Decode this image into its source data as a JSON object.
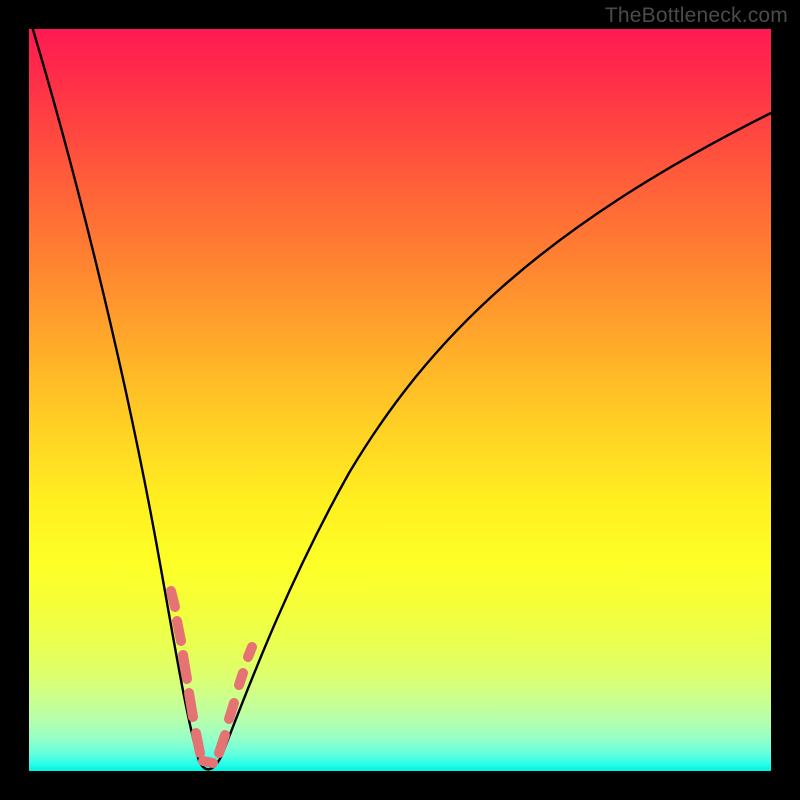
{
  "watermark": "TheBottleneck.com",
  "colors": {
    "frame": "#000000",
    "curve": "#000000",
    "marker": "#e57373",
    "gradient_stops": [
      {
        "pos": 0.0,
        "color": "#ff1a52"
      },
      {
        "pos": 0.5,
        "color": "#ffd224"
      },
      {
        "pos": 1.0,
        "color": "#00f3e0"
      }
    ]
  },
  "chart_data": {
    "type": "line",
    "title": "",
    "xlabel": "",
    "ylabel": "",
    "xlim": [
      0,
      100
    ],
    "ylim": [
      0,
      100
    ],
    "note": "x runs left→right 0–100% of plot width; y is bottleneck % (0 = bottom/green, 100 = top/red). Curve plunges to ~0 near x≈23 then rises asymptotically.",
    "series": [
      {
        "name": "bottleneck-curve",
        "x": [
          0,
          3,
          6,
          9,
          12,
          15,
          17,
          19,
          20,
          21,
          22,
          23,
          24,
          25,
          26,
          28,
          30,
          33,
          37,
          42,
          48,
          55,
          63,
          72,
          82,
          92,
          100
        ],
        "y": [
          100,
          91,
          81,
          71,
          60,
          48,
          38,
          28,
          20,
          12,
          5,
          1,
          1,
          4,
          9,
          18,
          27,
          37,
          47,
          56,
          64,
          71,
          77,
          82,
          85,
          88,
          89
        ]
      }
    ],
    "markers": {
      "name": "highlighted-points",
      "x": [
        19.5,
        20.2,
        20.6,
        21.2,
        21.4,
        22.1,
        22.9,
        24.0,
        25.1,
        25.6,
        26.4,
        26.9
      ],
      "y": [
        23.5,
        18.0,
        15.0,
        10.5,
        9.0,
        4.5,
        1.0,
        1.5,
        5.0,
        7.5,
        11.5,
        14.0
      ]
    }
  }
}
